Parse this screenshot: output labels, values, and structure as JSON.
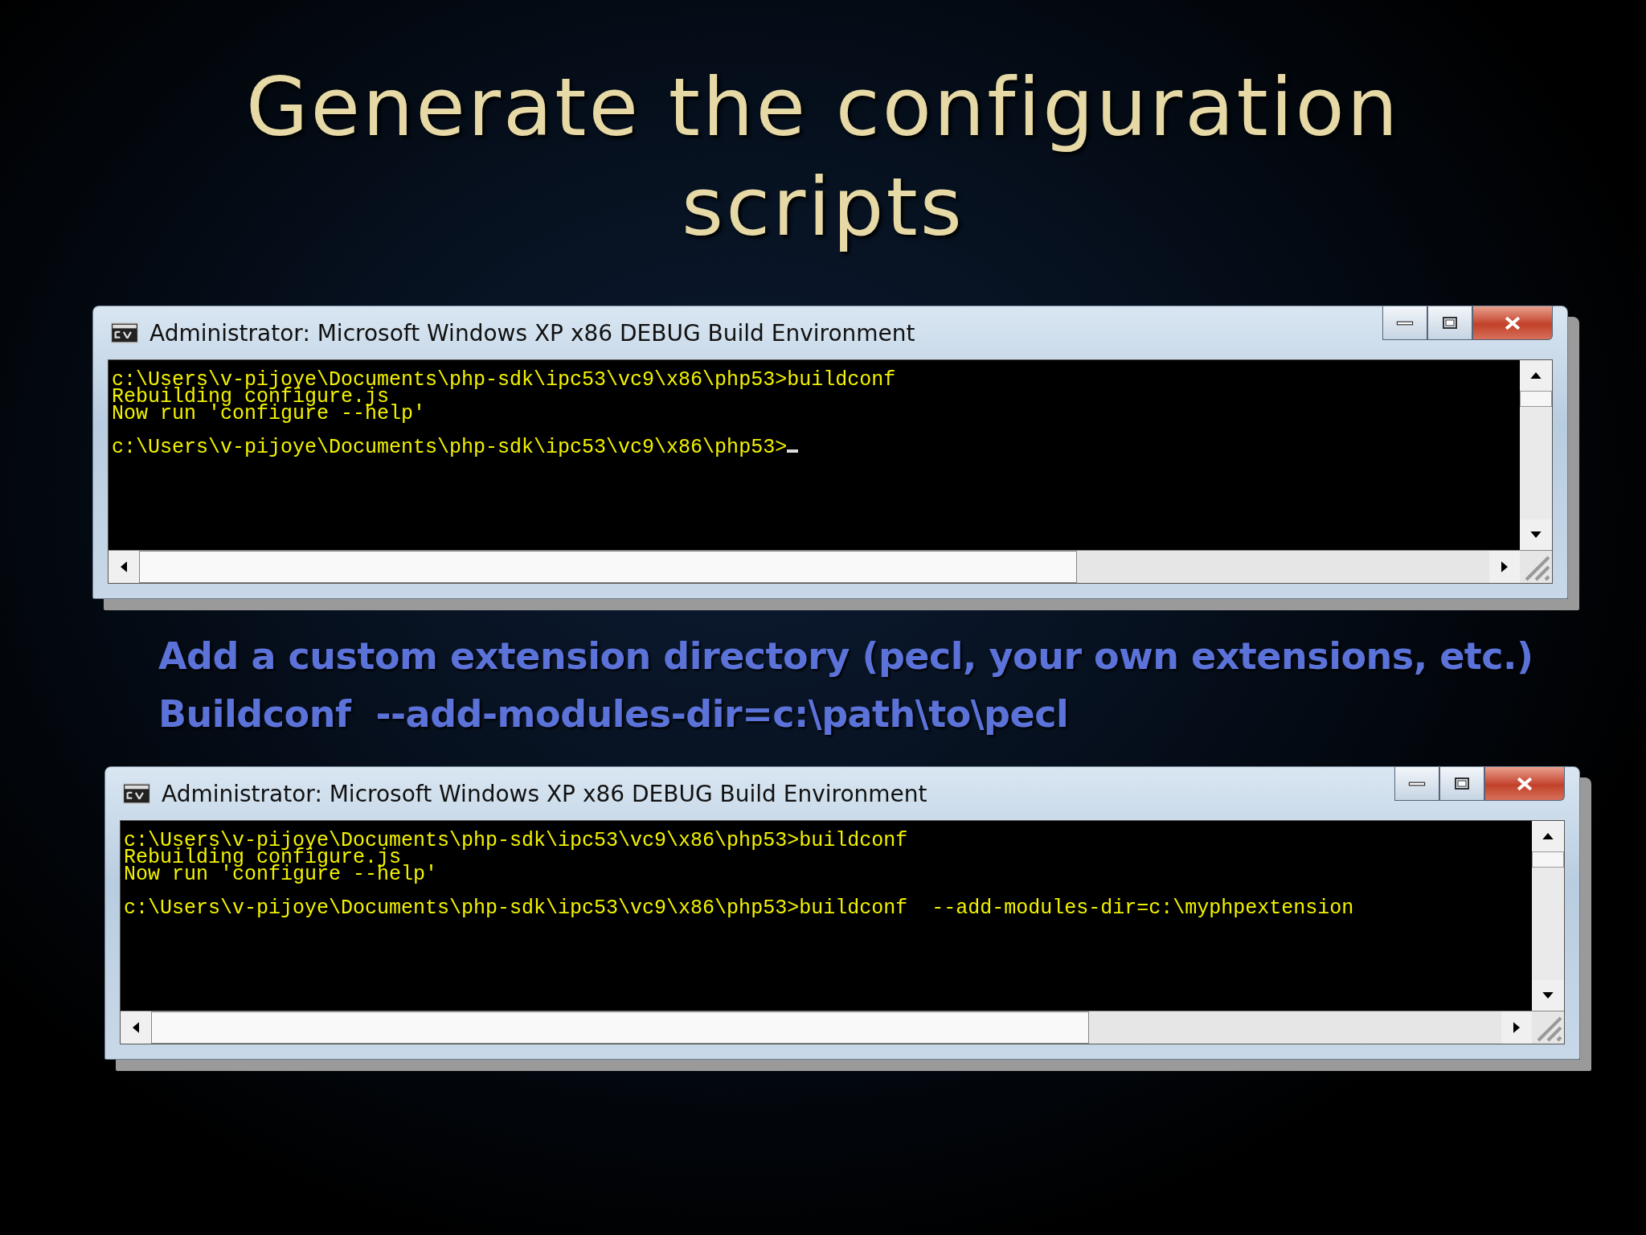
{
  "title": "Generate the configuration scripts",
  "consoles": [
    {
      "title": "Administrator:  Microsoft Windows XP x86 DEBUG Build Environment",
      "blocks": [
        [
          "c:\\Users\\v-pijoye\\Documents\\php-sdk\\ipc53\\vc9\\x86\\php53>buildconf",
          "Rebuilding configure.js",
          "Now run 'configure --help'"
        ],
        [
          "c:\\Users\\v-pijoye\\Documents\\php-sdk\\ipc53\\vc9\\x86\\php53>"
        ]
      ],
      "cursor": true
    },
    {
      "title": "Administrator:  Microsoft Windows XP x86 DEBUG Build Environment",
      "blocks": [
        [
          "c:\\Users\\v-pijoye\\Documents\\php-sdk\\ipc53\\vc9\\x86\\php53>buildconf",
          "Rebuilding configure.js",
          "Now run 'configure --help'"
        ],
        [
          "c:\\Users\\v-pijoye\\Documents\\php-sdk\\ipc53\\vc9\\x86\\php53>buildconf  --add-modules-dir=c:\\myphpextension"
        ]
      ],
      "cursor": false
    }
  ],
  "notes": [
    "Add a custom extension directory (pecl, your own extensions, etc.)",
    "Buildconf  --add-modules-dir=c:\\path\\to\\pecl"
  ]
}
